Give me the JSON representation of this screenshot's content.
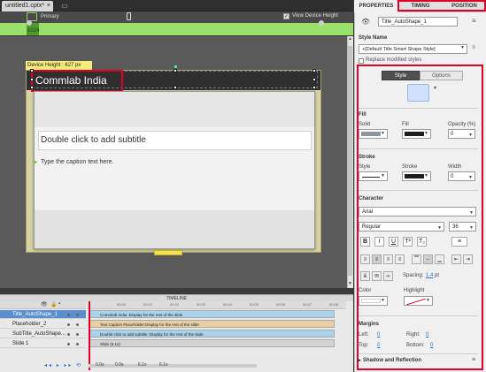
{
  "document": {
    "tab_label": "untitled1.cptx*",
    "close": "×",
    "menu": "▭"
  },
  "device_bar": {
    "primary": "Primary",
    "view_device_height": "View Device Height",
    "width_value": "1024",
    "check": "✓"
  },
  "stage": {
    "device_height_label": "Device Height : 627 px",
    "title_text": "Commlab India",
    "subtitle_placeholder": "Double click to add subtitle",
    "caption_text": "Type the caption text here.",
    "caption_marker": "▶"
  },
  "timeline": {
    "header": "TIMELINE",
    "ticks": [
      "00:00",
      "00:01",
      "00:02",
      "00:03",
      "00:04",
      "00:05",
      "00:06",
      "00:07",
      "00:08",
      "00:09",
      "00:10"
    ],
    "rows": [
      {
        "name": "Title_AutoShape_1",
        "bar": "Commlab India :Display for the rest of the slide",
        "color": "#a9d3ea",
        "selected": true
      },
      {
        "name": "Placeholder_2",
        "bar": "Text Caption Placeholder:Display for the rest of the slide",
        "color": "#e8cfa3",
        "selected": false
      },
      {
        "name": "SubTitle_AutoShape...",
        "bar": "Double click to add subtitle :Display for the rest of the slide",
        "color": "#a9d3ea",
        "selected": false
      },
      {
        "name": "Slide 1",
        "bar": "Slide (6.1s)",
        "color": "#d3d3d3",
        "selected": false
      }
    ],
    "controls": "◂◂ ▸ ▸▸ ⟲",
    "times": [
      "0.0s",
      "0.0s",
      "6.1s",
      "6.1s"
    ]
  },
  "panel": {
    "tabs": [
      "PROPERTIES",
      "TIMING",
      "POSITION"
    ],
    "object_name": "Title_AutoShape_1",
    "style_name_label": "Style Name",
    "style_value": "+[Default Title Smart Shape Style]",
    "replace_label": "Replace modified styles",
    "seg_style": "Style",
    "seg_options": "Options",
    "fill": {
      "label": "Fill",
      "solid": "Solid",
      "fill": "Fill",
      "opacity_label": "Opacity (%)",
      "opacity": "0",
      "solid_color": "#8e959d",
      "fill_color": "#1e1e1e"
    },
    "stroke": {
      "label": "Stroke",
      "style": "Style",
      "stroke": "Stroke",
      "width": "Width",
      "width_value": "0",
      "stroke_color": "#1e1e1e"
    },
    "character": {
      "label": "Character",
      "font": "Arial",
      "weight": "Regular",
      "size": "36"
    },
    "format_buttons": [
      "B",
      "I",
      "U",
      "T²",
      "T₂"
    ],
    "spacing_label": "Spacing:",
    "spacing_value": "1.4",
    "spacing_unit": "pt",
    "color_label": "Color",
    "highlight_label": "Highlight",
    "margins": {
      "label": "Margins",
      "left": "Left:",
      "right": "Right:",
      "top": "Top:",
      "bottom": "Bottom:",
      "left_v": "0",
      "right_v": "0",
      "top_v": "0",
      "bottom_v": "0"
    },
    "shadow_label": "Shadow and Reflection"
  }
}
